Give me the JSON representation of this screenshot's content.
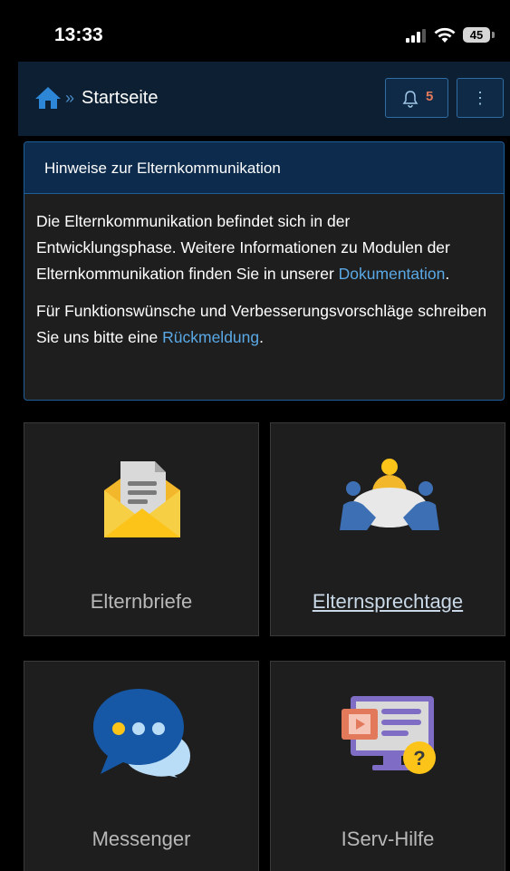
{
  "status_bar": {
    "time": "13:33",
    "battery": "45"
  },
  "navbar": {
    "breadcrumb_separator": "»",
    "title": "Startseite",
    "notification_count": "5",
    "menu_glyph": "⋮"
  },
  "notice": {
    "title": "Hinweise zur Elternkommunikation",
    "para1_text": "Die Elternkommunikation befindet sich in der Entwicklungsphase. Weitere Informationen zu Modulen der Elternkommunikation finden Sie in unserer ",
    "para1_link": "Dokumentation",
    "para1_end": ".",
    "para2_text": "Für Funktionswünsche und Verbesserungsvorschläge schreiben Sie uns bitte eine ",
    "para2_link": "Rückmeldung",
    "para2_end": "."
  },
  "tiles": [
    {
      "label": "Elternbriefe",
      "icon": "envelope-letter-icon"
    },
    {
      "label": "Elternsprechtage",
      "icon": "meeting-table-icon"
    },
    {
      "label": "Messenger",
      "icon": "chat-bubbles-icon"
    },
    {
      "label": "IServ-Hilfe",
      "icon": "help-monitor-icon"
    }
  ],
  "colors": {
    "navbar_bg": "#0c1f33",
    "notice_header_bg": "#0c2b4d",
    "link": "#5aa9e6",
    "badge": "#e2795b",
    "tile_bg": "#1e1e1e"
  }
}
